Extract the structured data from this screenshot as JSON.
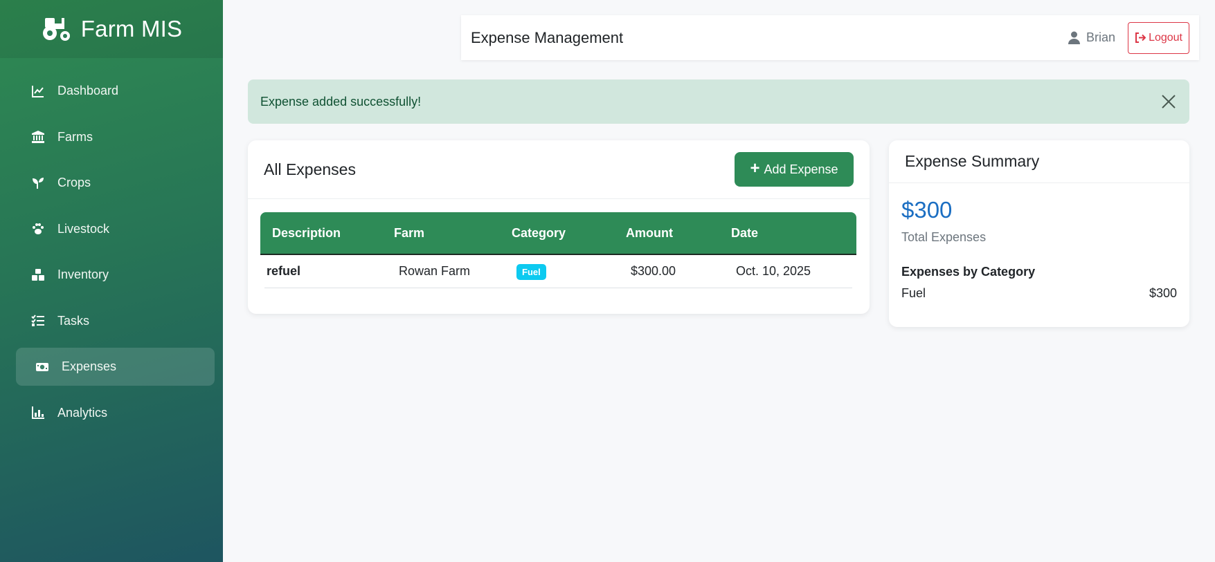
{
  "app": {
    "title": "Farm MIS"
  },
  "sidebar": {
    "items": [
      {
        "label": "Dashboard",
        "icon": "chart-line-icon"
      },
      {
        "label": "Farms",
        "icon": "bank-icon"
      },
      {
        "label": "Crops",
        "icon": "seedling-icon"
      },
      {
        "label": "Livestock",
        "icon": "paw-icon"
      },
      {
        "label": "Inventory",
        "icon": "boxes-icon"
      },
      {
        "label": "Tasks",
        "icon": "tasks-icon"
      },
      {
        "label": "Expenses",
        "icon": "money-bill-icon",
        "active": true
      },
      {
        "label": "Analytics",
        "icon": "chart-bar-icon"
      }
    ]
  },
  "header": {
    "title": "Expense Management",
    "user": "Brian",
    "logout_label": "Logout"
  },
  "alert": {
    "message": "Expense added successfully!"
  },
  "expenses": {
    "title": "All Expenses",
    "add_label": "Add Expense",
    "columns": [
      "Description",
      "Farm",
      "Category",
      "Amount",
      "Date"
    ],
    "rows": [
      {
        "description": "refuel",
        "farm": "Rowan Farm",
        "category": "Fuel",
        "amount": "$300.00",
        "date": "Oct. 10, 2025"
      }
    ]
  },
  "summary": {
    "title": "Expense Summary",
    "total": "$300",
    "total_label": "Total Expenses",
    "category_title": "Expenses by Category",
    "categories": [
      {
        "name": "Fuel",
        "amount": "$300"
      }
    ]
  },
  "colors": {
    "primary": "#2e8b57",
    "alert_bg": "#d1e7dd",
    "badge": "#0dcaf0",
    "total": "#1b6ec2",
    "danger": "#dc3545"
  }
}
